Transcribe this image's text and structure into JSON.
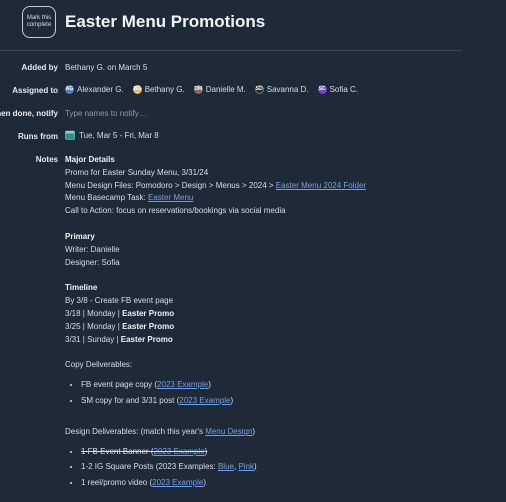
{
  "header": {
    "complete_label": "Mark this complete",
    "title": "Easter Menu Promotions"
  },
  "fields": {
    "added_by_label": "Added by",
    "added_by_value": "Bethany G. on March 5",
    "assigned_label": "Assigned to",
    "assignees": [
      {
        "name": "Alexander G.",
        "color": "#5a7fbf",
        "initials": "AG"
      },
      {
        "name": "Bethany G.",
        "color": "#e3c06a",
        "initials": "BG"
      },
      {
        "name": "Danielle M.",
        "color": "#8a6a5a",
        "initials": "DM"
      },
      {
        "name": "Savanna D.",
        "color": "#2b2b2b",
        "initials": "SD"
      },
      {
        "name": "Sofia C.",
        "color": "#7b3fd6",
        "initials": "SC"
      }
    ],
    "notify_label": "When done, notify",
    "notify_placeholder": "Type names to notify…",
    "runs_label": "Runs from",
    "runs_value": "Tue, Mar 5 - Fri, Mar 8",
    "notes_label": "Notes"
  },
  "notes": {
    "major_heading": "Major Details",
    "promo_line": "Promo for Easter Sunday Menu, 3/31/24",
    "design_files_prefix": "Menu Design Files: Pomodoro > Design > Menus > 2024 > ",
    "design_files_link": "Easter Menu 2024 Folder",
    "basecamp_prefix": "Menu Basecamp Task: ",
    "basecamp_link": "Easter Menu",
    "cta_line": "Call to Action: focus on reservations/bookings via social media",
    "primary_heading": "Primary",
    "writer": "Writer: Danielle",
    "designer": "Designer: Sofia",
    "timeline_heading": "Timeline",
    "timeline_1": "By 3/8 - Create FB event page",
    "timeline_2_prefix": "3/18 | Monday | ",
    "timeline_2_bold": "Easter Promo",
    "timeline_3_prefix": "3/25 | Monday | ",
    "timeline_3_bold": "Easter Promo",
    "timeline_4_prefix": "3/31 | Sunday | ",
    "timeline_4_bold": "Easter Promo",
    "copy_heading": "Copy Deliverables:",
    "copy_1_prefix": "FB event page copy (",
    "copy_1_link": "2023 Example",
    "copy_1_suffix": ")",
    "copy_2_prefix": "SM copy for and 3/31 post (",
    "copy_2_link": "2023 Example",
    "copy_2_suffix": ")",
    "design_heading_prefix": "Design Deliverables: (match this year's ",
    "design_heading_link": "Menu Design",
    "design_heading_suffix": ")",
    "design_1_prefix": "1 FB Event Banner (",
    "design_1_link": "2023 Example",
    "design_1_suffix": ")",
    "design_2_prefix": "1-2 IG Square Posts (2023 Examples: ",
    "design_2_link_a": "Blue",
    "design_2_sep": ", ",
    "design_2_link_b": "Pink",
    "design_2_suffix": ")",
    "design_3_prefix": "1 reel/promo video (",
    "design_3_link": "2023 Example",
    "design_3_suffix": ")"
  }
}
